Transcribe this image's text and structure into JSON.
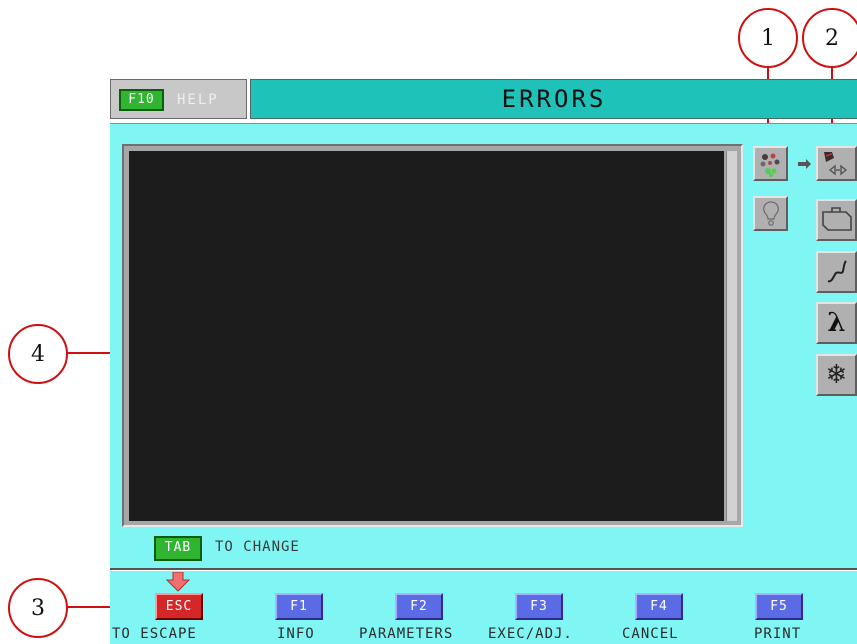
{
  "header": {
    "help_key": "F10",
    "help_label": "HELP",
    "title": "ERRORS"
  },
  "sidebar_icons": {
    "col1": [
      "molecule-icon",
      "lightbulb-icon"
    ],
    "col2": [
      "fuel-injector-icon",
      "engine-icon",
      "wave-icon",
      "lambda-icon",
      "snowflake-icon"
    ],
    "lambda_symbol": "λ",
    "snowflake_symbol": "❄"
  },
  "tab_hint": {
    "key": "TAB",
    "label": "TO CHANGE"
  },
  "function_keys": [
    {
      "key": "ESC",
      "label": "TO ESCAPE"
    },
    {
      "key": "F1",
      "label": "INFO"
    },
    {
      "key": "F2",
      "label": "PARAMETERS"
    },
    {
      "key": "F3",
      "label": "EXEC/ADJ."
    },
    {
      "key": "F4",
      "label": "CANCEL"
    },
    {
      "key": "F5",
      "label": "PRINT"
    }
  ],
  "callouts": [
    "1",
    "2",
    "3",
    "4"
  ],
  "colors": {
    "panel": "#80f6f4",
    "title_bar": "#1fc2b8",
    "green_key": "#2fb52f",
    "blue_key": "#5b6be6",
    "esc_key": "#d42828",
    "callout_line": "#d01010"
  }
}
